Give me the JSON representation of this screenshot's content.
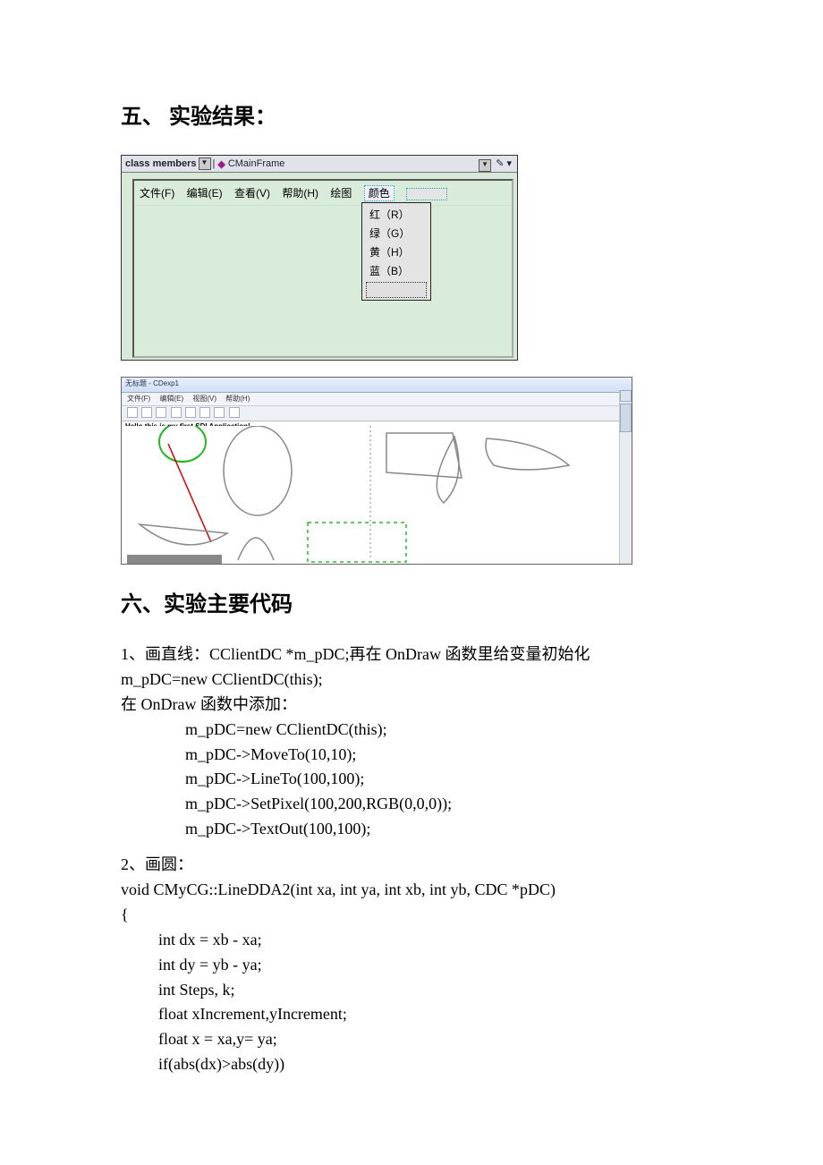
{
  "headings": {
    "section5": "五、 实验结果：",
    "section6": "六、实验主要代码"
  },
  "shot1": {
    "classmembers": "class members",
    "mainframe": "CMainFrame",
    "menu": {
      "file": "文件(F)",
      "edit": "编辑(E)",
      "view": "查看(V)",
      "help": "帮助(H)",
      "draw": "绘图",
      "color": "颜色"
    },
    "dropdown": {
      "red": "红（R）",
      "green": "绿（G）",
      "yellow": "黄（H）",
      "blue": "蓝（B）"
    }
  },
  "shot2": {
    "title": "无标题 - CDexp1",
    "menu": {
      "file": "文件(F)",
      "edit": "编辑(E)",
      "view": "视图(V)",
      "help": "帮助(H)"
    },
    "textline": "Hello,this is my first SDI Application!"
  },
  "code": {
    "p1_l1": "1、画直线：CClientDC *m_pDC;再在 OnDraw 函数里给变量初始化",
    "p1_l2": "m_pDC=new CClientDC(this);",
    "p1_l3": "在 OnDraw 函数中添加：",
    "p1_c1": "m_pDC=new CClientDC(this);",
    "p1_c2": "m_pDC->MoveTo(10,10);",
    "p1_c3": "m_pDC->LineTo(100,100);",
    "p1_c4": "m_pDC->SetPixel(100,200,RGB(0,0,0));",
    "p1_c5": "m_pDC->TextOut(100,100);",
    "p2_l1": "2、画圆：",
    "p2_l2": "void CMyCG::LineDDA2(int xa, int ya, int xb, int yb, CDC *pDC)",
    "p2_l3": "{",
    "p2_c1": "int dx =   xb - xa;",
    "p2_c2": "int dy =   yb - ya;",
    "p2_c3": "int Steps, k;",
    "p2_c4": "float xIncrement,yIncrement;",
    "p2_c5": "float x = xa,y= ya;",
    "p2_c6": "if(abs(dx)>abs(dy))"
  }
}
